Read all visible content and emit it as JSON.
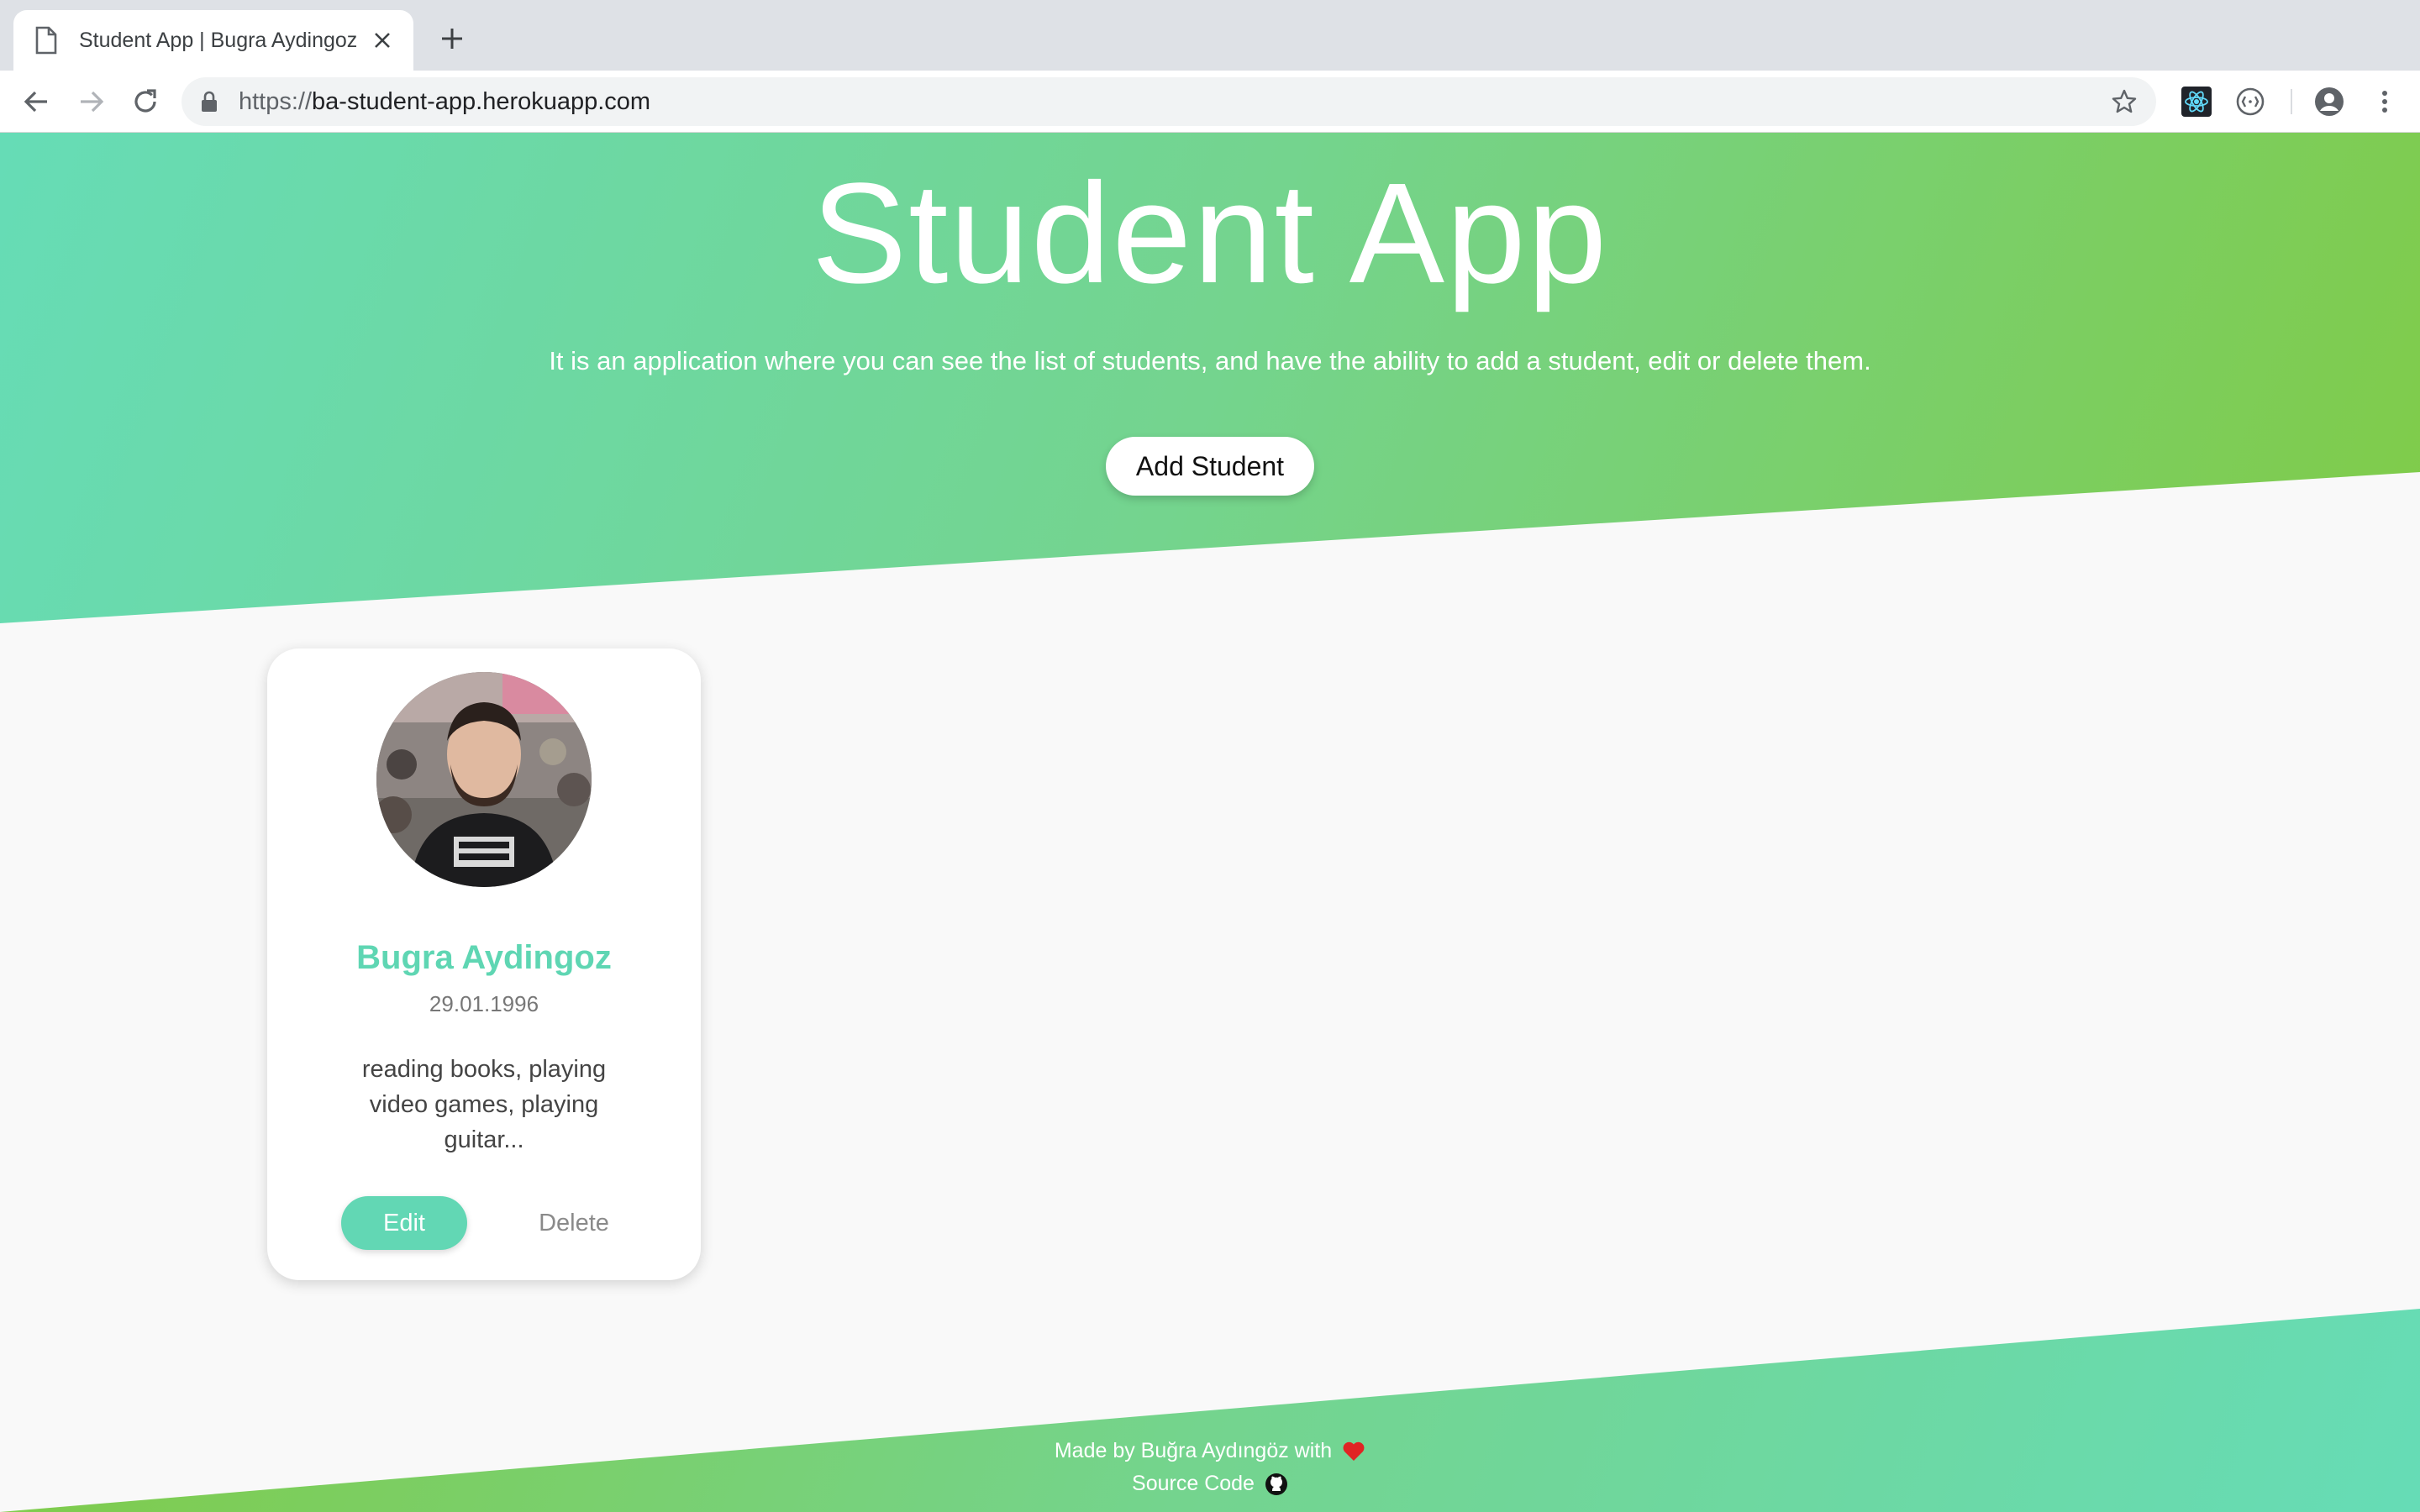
{
  "browser": {
    "tab_title": "Student App | Bugra Aydingoz",
    "url_scheme": "https://",
    "url_host": "ba-student-app.herokuapp.com"
  },
  "hero": {
    "title": "Student App",
    "description": "It is an application where you can see the list of students, and have the ability to add a student, edit or delete them.",
    "add_button": "Add Student"
  },
  "students": [
    {
      "name": "Bugra Aydingoz",
      "birth_date": "29.01.1996",
      "hobbies": "reading books, playing video games, playing guitar...",
      "edit_label": "Edit",
      "delete_label": "Delete"
    }
  ],
  "footer": {
    "made_by": "Made by Buğra Aydıngöz with",
    "source_code": "Source Code"
  },
  "colors": {
    "accent": "#62d7b4",
    "gradient_start": "#66dcb6",
    "gradient_end": "#80cb48",
    "heart": "#e02424"
  },
  "icons": [
    "document-icon",
    "close-icon",
    "plus-icon",
    "back-icon",
    "forward-icon",
    "reload-icon",
    "lock-icon",
    "star-icon",
    "react-devtools-icon",
    "extension-icon",
    "account-icon",
    "menu-icon",
    "heart-icon",
    "github-icon"
  ]
}
